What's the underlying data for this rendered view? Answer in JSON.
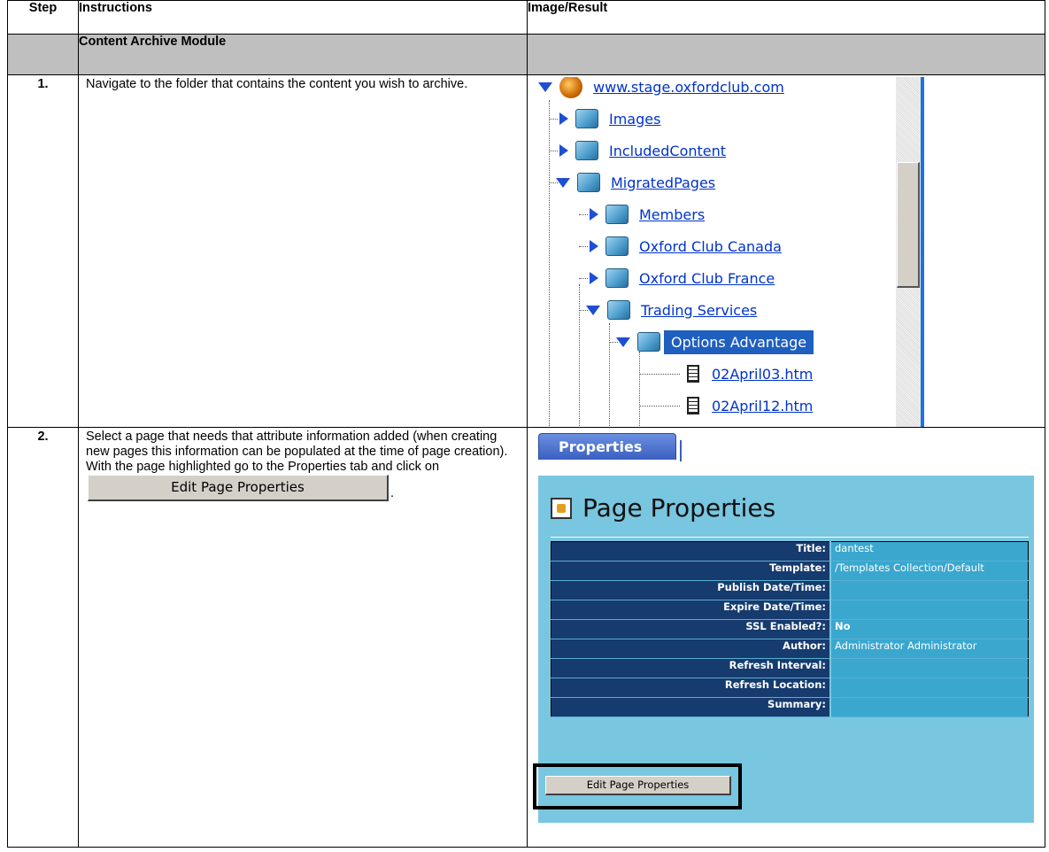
{
  "headers": {
    "step": "Step",
    "instructions": "Instructions",
    "image_result": "Image/Result"
  },
  "section_title": "Content Archive Module",
  "steps": [
    {
      "number": "1.",
      "text": "Navigate to the folder that contains the content you wish to archive."
    },
    {
      "number": "2.",
      "text_before": "Select a page that needs that attribute information added (when creating new pages this information can be populated at the time of page creation). With the page highlighted go to the Properties tab and click on",
      "inline_button": "Edit Page Properties",
      "text_after": "."
    }
  ],
  "tree": {
    "root": "www.stage.oxfordclub.com",
    "items": [
      "Images",
      "IncludedContent",
      "MigratedPages",
      "Members",
      "Oxford Club Canada",
      "Oxford Club France",
      "Trading Services",
      "Options Advantage",
      "02April03.htm",
      "02April12.htm"
    ]
  },
  "properties": {
    "tab_label": "Properties",
    "panel_title": "Page Properties",
    "fields": [
      {
        "label": "Title:",
        "value": "dantest"
      },
      {
        "label": "Template:",
        "value": "/Templates Collection/Default"
      },
      {
        "label": "Publish Date/Time:",
        "value": ""
      },
      {
        "label": "Expire Date/Time:",
        "value": ""
      },
      {
        "label": "SSL Enabled?:",
        "value": "No"
      },
      {
        "label": "Author:",
        "value": "Administrator Administrator"
      },
      {
        "label": "Refresh Interval:",
        "value": ""
      },
      {
        "label": "Refresh Location:",
        "value": ""
      },
      {
        "label": "Summary:",
        "value": ""
      }
    ],
    "edit_button": "Edit Page Properties"
  },
  "colors": {
    "section_bg": "#bfbfbf",
    "panel_bg": "#79c6e0",
    "label_bg": "#163b6e",
    "value_bg": "#3aa7cf",
    "link": "#0033cc",
    "selection": "#1e5fbf"
  }
}
